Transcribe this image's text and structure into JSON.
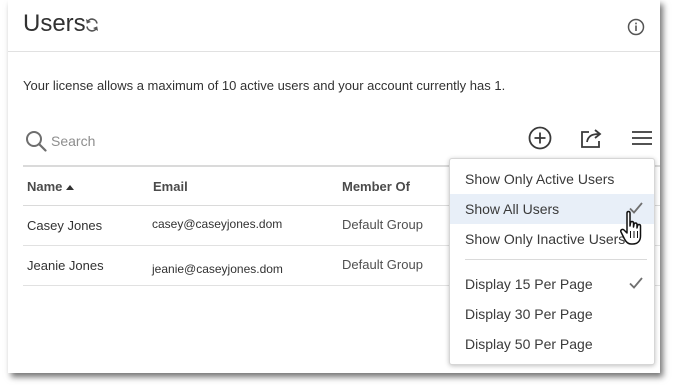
{
  "header": {
    "title": "Users",
    "refresh_icon": "refresh-icon",
    "info_icon": "info-icon"
  },
  "license_text": "Your license allows a maximum of 10 active users and your account currently has 1.",
  "search": {
    "placeholder": "Search",
    "value": ""
  },
  "toolbar": {
    "add_icon": "plus-circle-icon",
    "share_icon": "share-icon",
    "menu_icon": "hamburger-icon"
  },
  "table": {
    "columns": [
      "Name",
      "Email",
      "Member Of"
    ],
    "sort_column": "Name",
    "rows": [
      {
        "name": "Casey Jones",
        "email": "casey@caseyjones.dom",
        "group": "Default Group"
      },
      {
        "name": "Jeanie Jones",
        "email": "jeanie@caseyjones.dom",
        "group": "Default Group"
      }
    ]
  },
  "menu": {
    "filter_items": [
      {
        "label": "Show Only Active Users",
        "checked": false
      },
      {
        "label": "Show All Users",
        "checked": true
      },
      {
        "label": "Show Only Inactive Users",
        "checked": false
      }
    ],
    "page_items": [
      {
        "label": "Display 15 Per Page",
        "checked": true
      },
      {
        "label": "Display 30 Per Page",
        "checked": false
      },
      {
        "label": "Display 50 Per Page",
        "checked": false
      }
    ]
  },
  "colors": {
    "menu_highlight": "#e8eff8",
    "divider": "#dadada",
    "text": "#323232"
  }
}
